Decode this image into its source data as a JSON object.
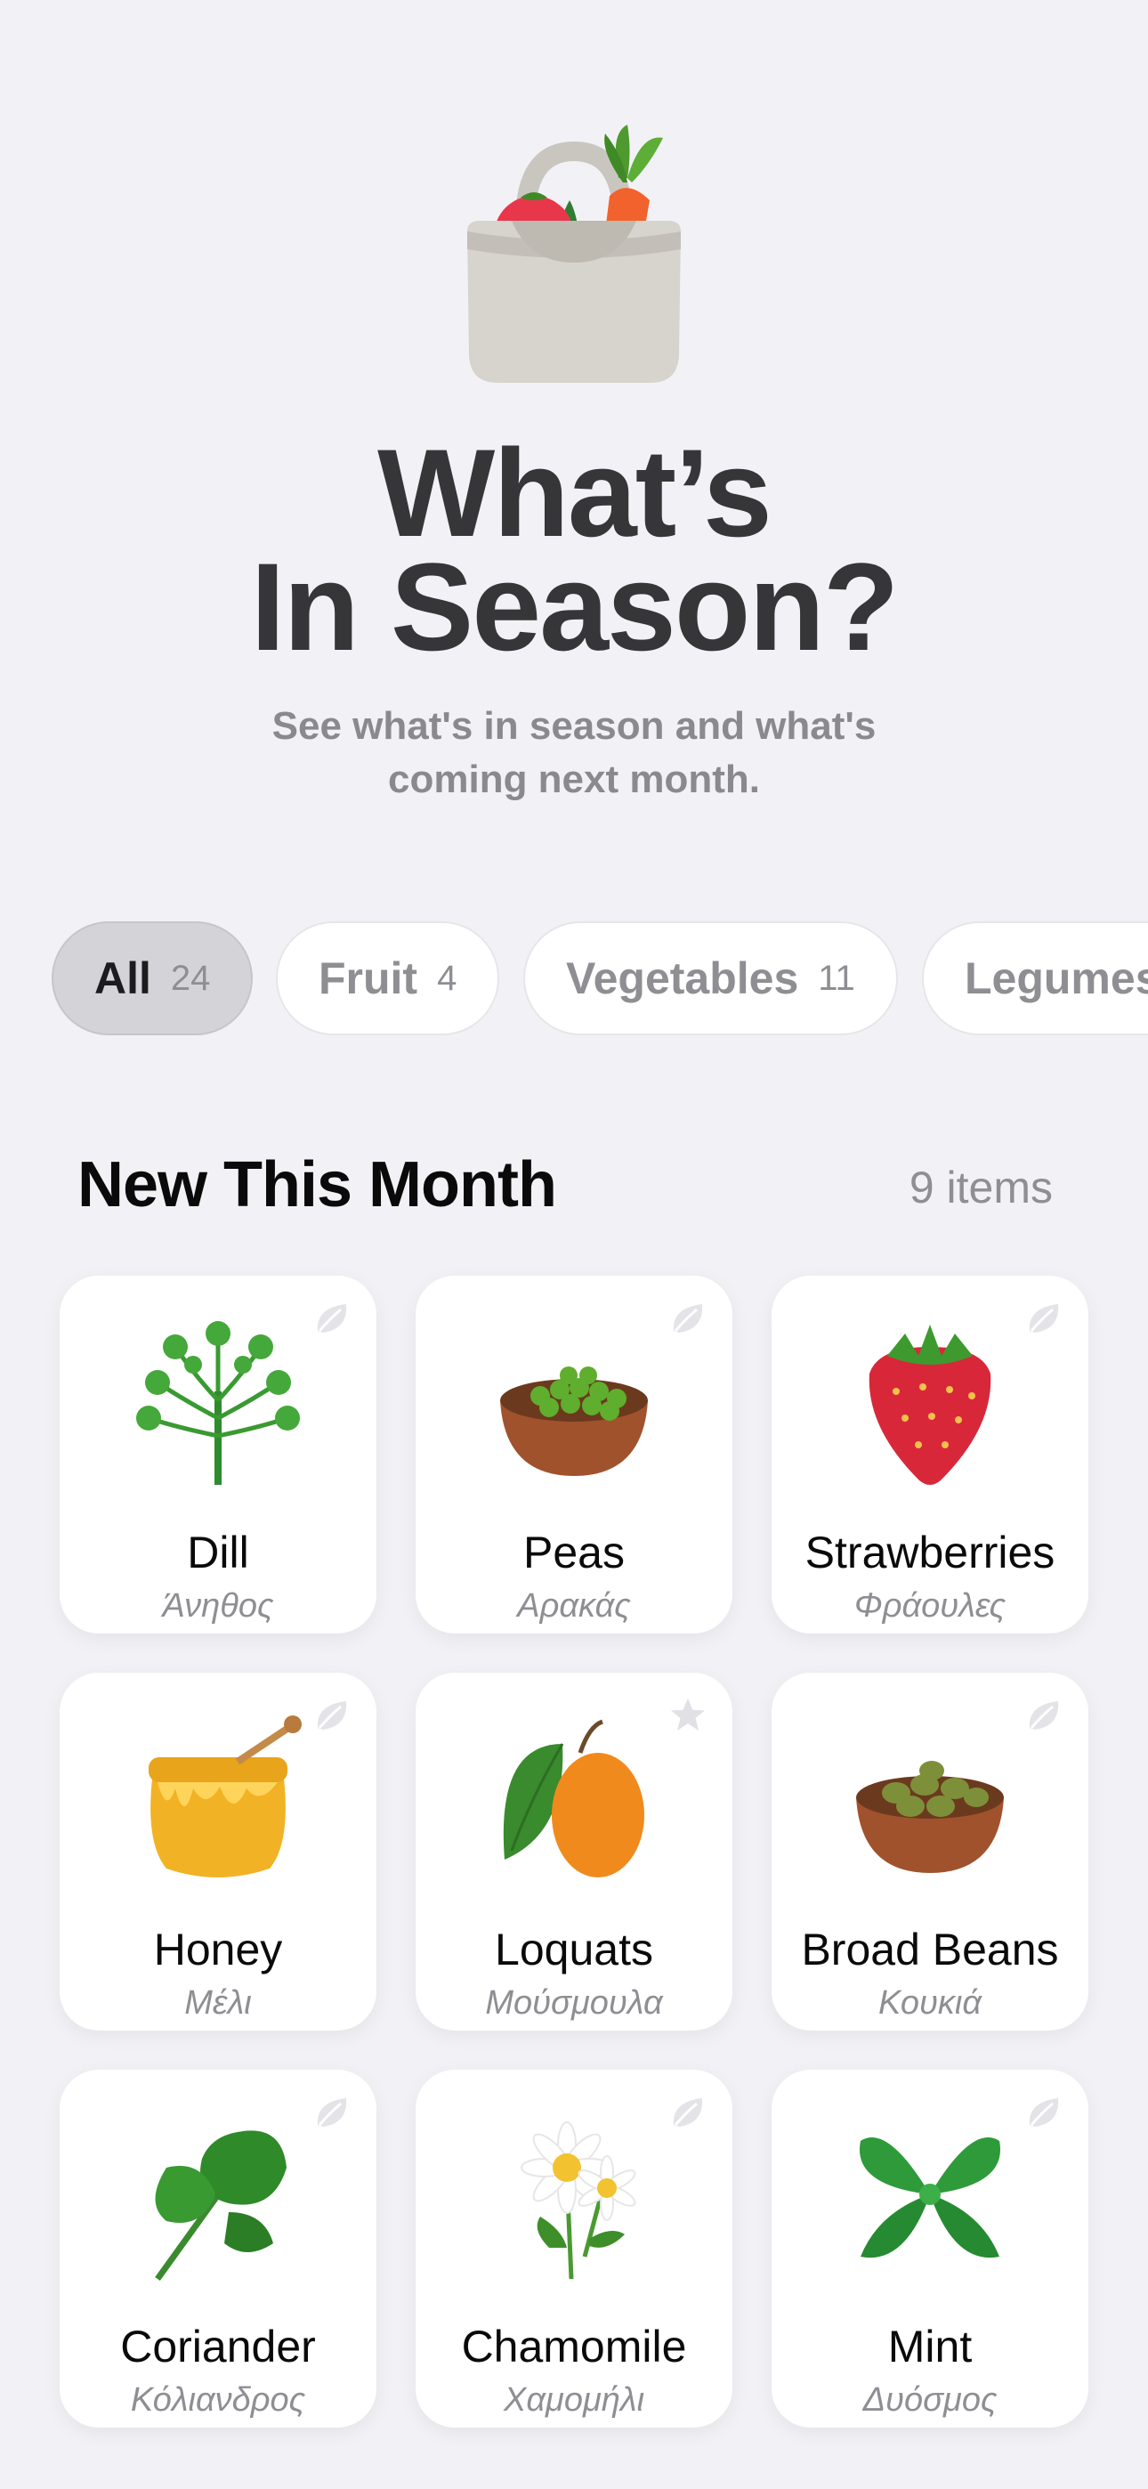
{
  "hero": {
    "icon": "grocery-bag-icon",
    "title_line1": "What’s",
    "title_line2": "In Season?",
    "subtitle_line1": "See what's in season and what's",
    "subtitle_line2": "coming next month."
  },
  "filters": [
    {
      "label": "All",
      "count": "24",
      "selected": true
    },
    {
      "label": "Fruit",
      "count": "4",
      "selected": false
    },
    {
      "label": "Vegetables",
      "count": "11",
      "selected": false
    },
    {
      "label": "Legumes",
      "count": "",
      "selected": false
    }
  ],
  "section": {
    "title": "New This Month",
    "count": "9 items"
  },
  "items": [
    {
      "name": "Dill",
      "greek": "Άνηθος",
      "icon": "dill-icon",
      "badge": "leaf-icon"
    },
    {
      "name": "Peas",
      "greek": "Αρακάς",
      "icon": "peas-bowl-icon",
      "badge": "leaf-icon"
    },
    {
      "name": "Strawberries",
      "greek": "Φράουλες",
      "icon": "strawberry-icon",
      "badge": "leaf-icon"
    },
    {
      "name": "Honey",
      "greek": "Μέλι",
      "icon": "honey-pot-icon",
      "badge": "leaf-icon"
    },
    {
      "name": "Loquats",
      "greek": "Μούσμουλα",
      "icon": "loquat-icon",
      "badge": "star-icon"
    },
    {
      "name": "Broad Beans",
      "greek": "Κουκιά",
      "icon": "broad-beans-bowl-icon",
      "badge": "leaf-icon"
    },
    {
      "name": "Coriander",
      "greek": "Κόλιανδρος",
      "icon": "coriander-icon",
      "badge": "leaf-icon"
    },
    {
      "name": "Chamomile",
      "greek": "Χαμομήλι",
      "icon": "chamomile-icon",
      "badge": "leaf-icon"
    },
    {
      "name": "Mint",
      "greek": "Δυόσμος",
      "icon": "mint-icon",
      "badge": "leaf-icon"
    }
  ],
  "colors": {
    "background": "#F2F2F6",
    "card": "#FFFFFF",
    "chip_selected": "#D4D4D8",
    "secondary_text": "#8E8E93"
  }
}
